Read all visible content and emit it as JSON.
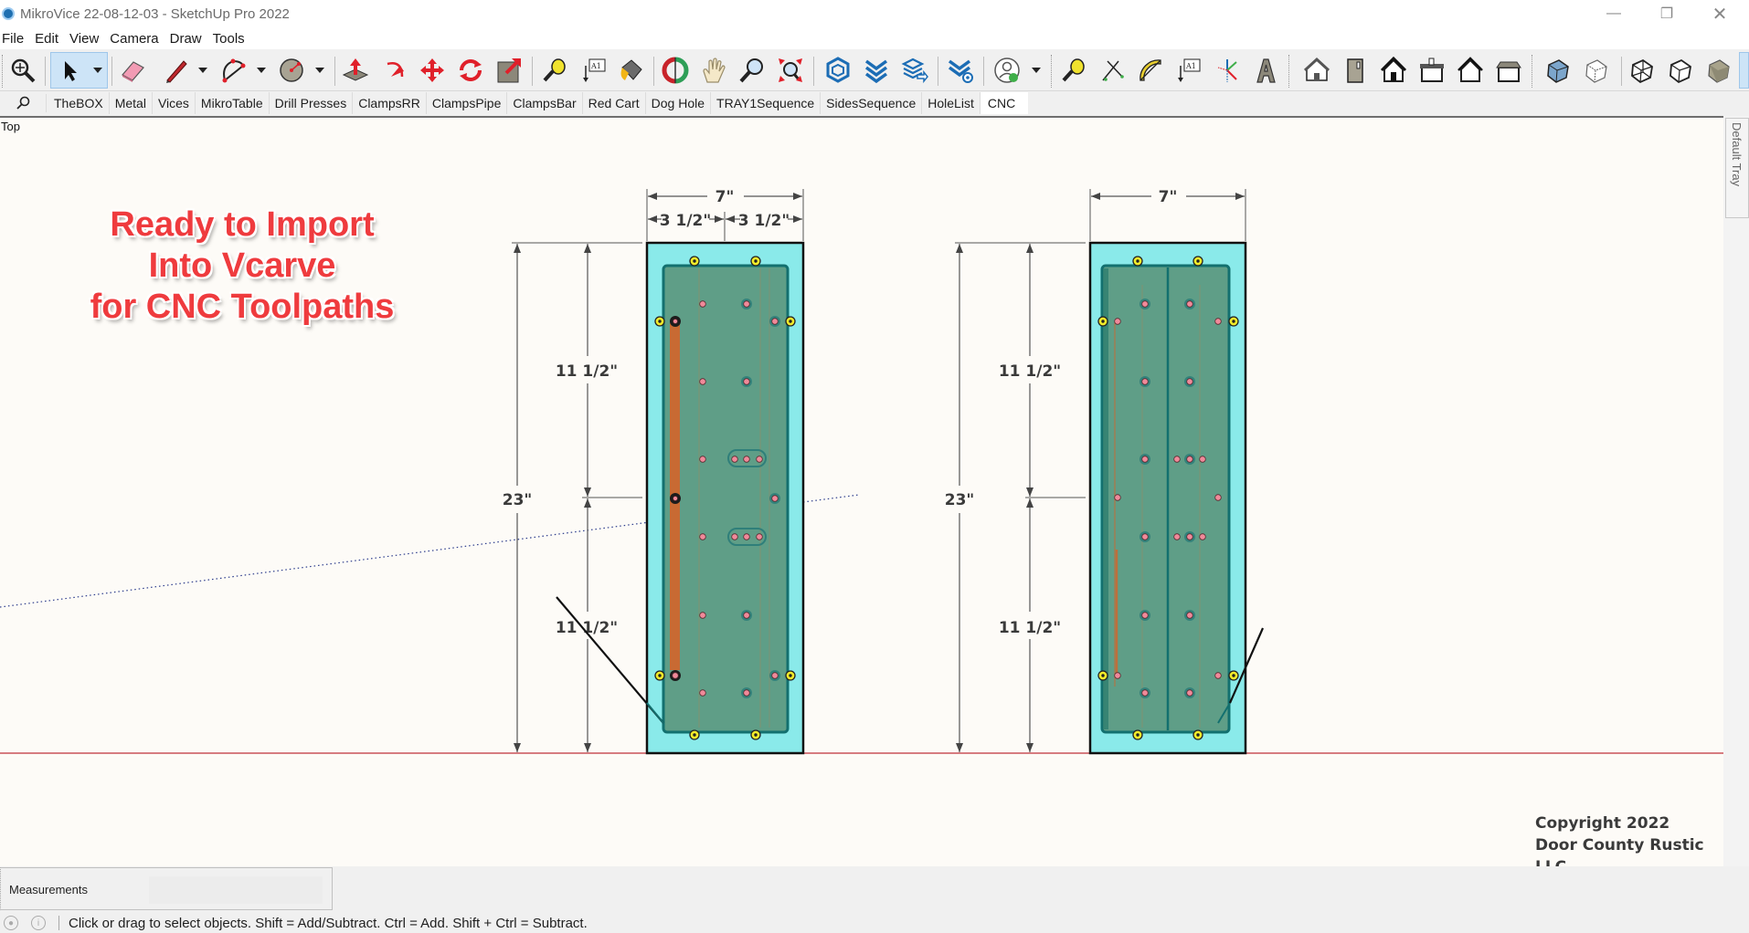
{
  "window": {
    "title": "MikroVice 22-08-12-03 - SketchUp Pro 2022",
    "controls": [
      "minimize",
      "restore",
      "close"
    ]
  },
  "menu": [
    "File",
    "Edit",
    "View",
    "Camera",
    "Draw",
    "Tools"
  ],
  "toolbar": {
    "icons": [
      "zoom-extents-icon",
      "select-icon",
      "eraser-icon",
      "pencil-line-icon",
      "arc-icon",
      "circle-icon",
      "push-pull-icon",
      "follow-me-icon",
      "move-icon",
      "rotate-icon",
      "scale-icon",
      "tape-measure-icon",
      "text-icon",
      "paint-bucket-icon",
      "orbit-icon",
      "pan-icon",
      "zoom-icon",
      "zoom-window-icon",
      "3d-warehouse-icon",
      "extension-warehouse-icon",
      "layout-send-icon",
      "extension-manager-icon",
      "account-icon",
      "tape-measure-icon",
      "dimension-icon",
      "protractor-icon",
      "text-icon",
      "axes-icon",
      "3d-text-icon",
      "iso-view-icon",
      "top-view-icon",
      "front-view-icon",
      "right-view-icon",
      "back-view-icon",
      "left-view-icon",
      "xray-icon",
      "back-edges-icon",
      "wireframe-icon",
      "hidden-line-icon",
      "shaded-icon"
    ]
  },
  "tabs": {
    "search_icon": "search-icon",
    "items": [
      "TheBOX",
      "Metal",
      "Vices",
      "MikroTable",
      "Drill Presses",
      "ClampsRR",
      "ClampsPipe",
      "ClampsBar",
      "Red Cart",
      "Dog Hole",
      "TRAY1Sequence",
      "SidesSequence",
      "HoleList",
      "CNC"
    ],
    "active": "CNC"
  },
  "viewport": {
    "view_label": "Top",
    "overlay_lines": [
      "Ready to Import",
      "Into Vcarve",
      "for CNC Toolpaths"
    ],
    "copyright_lines": [
      "Copyright 2022",
      "Door County Rustic LLC"
    ],
    "tray_label": "Default Tray",
    "panel_left": {
      "width_dim": "7\"",
      "half_dims": [
        "3 1/2\"",
        "3 1/2\""
      ],
      "height_dim": "23\"",
      "section_dims": [
        "11 1/2\"",
        "11 1/2\""
      ]
    },
    "panel_right": {
      "width_dim": "7\"",
      "height_dim": "23\"",
      "section_dims": [
        "11 1/2\"",
        "11 1/2\""
      ]
    },
    "colors": {
      "outer_fill": "#8aeaea",
      "inner_fill": "#5f9e87",
      "inner_edge": "#13706f",
      "hole_pink": "#f08a9a",
      "clamp_yellow": "#f2ec2a",
      "axis_red": "#c0303a"
    }
  },
  "measurements": {
    "label": "Measurements",
    "value": ""
  },
  "status": {
    "icons": [
      "geolocation-icon",
      "credits-icon"
    ],
    "text": "Click or drag to select objects. Shift = Add/Subtract. Ctrl = Add. Shift + Ctrl = Subtract."
  }
}
